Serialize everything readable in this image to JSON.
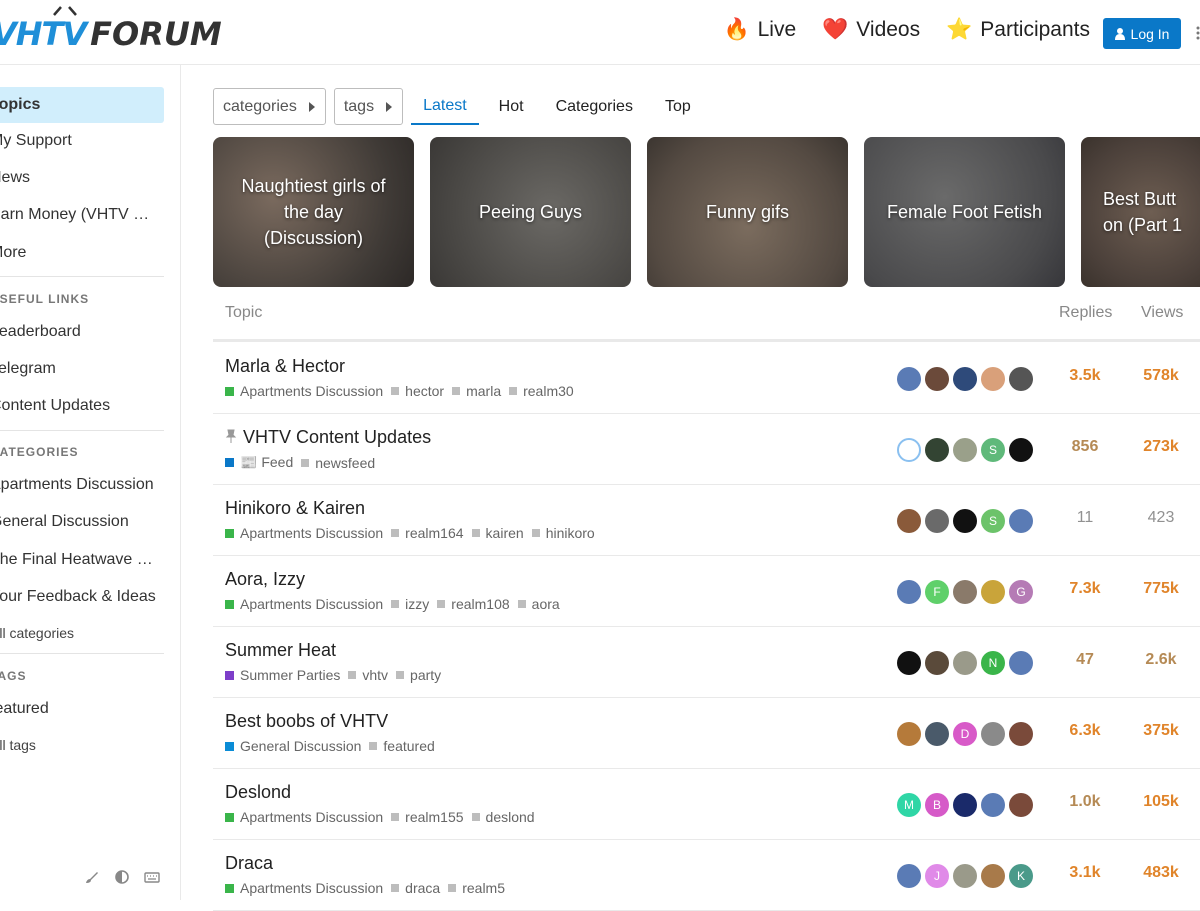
{
  "header": {
    "logo_left": "VHTV",
    "logo_right": "FORUM",
    "nav": [
      {
        "emoji": "🔥",
        "label": "Live"
      },
      {
        "emoji": "❤️",
        "label": "Videos"
      },
      {
        "emoji": "⭐",
        "label": "Participants"
      }
    ],
    "login_label": "Log In"
  },
  "sidebar": {
    "items": [
      "Topics",
      "My Support",
      "News",
      "Earn Money (VHTV …",
      "More"
    ],
    "useful_links_head": "USEFUL LINKS",
    "useful_links": [
      "Leaderboard",
      "Telegram",
      "Content Updates"
    ],
    "categories_head": "CATEGORIES",
    "categories": [
      "Apartments Discussion",
      "General Discussion",
      "The Final Heatwave …",
      "Your Feedback & Ideas"
    ],
    "all_categories": "All categories",
    "tags_head": "TAGS",
    "tags": [
      "featured"
    ],
    "all_tags": "All tags"
  },
  "filters": {
    "categories": "categories",
    "tags": "tags",
    "tabs": [
      "Latest",
      "Hot",
      "Categories",
      "Top"
    ]
  },
  "featured": [
    {
      "title": "Naughtiest girls of the day (Discussion)"
    },
    {
      "title": "Peeing Guys"
    },
    {
      "title": "Funny gifs"
    },
    {
      "title": "Female Foot Fetish"
    },
    {
      "title": "Best Butt on (Part 1"
    }
  ],
  "table": {
    "col_topic": "Topic",
    "col_replies": "Replies",
    "col_views": "Views",
    "rows": [
      {
        "title": "Marla & Hector",
        "pinned": false,
        "category": "Apartments Discussion",
        "cat_color": "#3ab54a",
        "tags": [
          "hector",
          "marla",
          "realm30"
        ],
        "replies": "3.5k",
        "views": "578k"
      },
      {
        "title": "VHTV Content Updates",
        "pinned": true,
        "category": "📰 Feed",
        "cat_color": "#0a78c8",
        "tags": [
          "newsfeed"
        ],
        "replies": "856",
        "views": "273k"
      },
      {
        "title": "Hinikoro & Kairen",
        "pinned": false,
        "category": "Apartments Discussion",
        "cat_color": "#3ab54a",
        "tags": [
          "realm164",
          "kairen",
          "hinikoro"
        ],
        "replies": "11",
        "views": "423"
      },
      {
        "title": "Aora, Izzy",
        "pinned": false,
        "category": "Apartments Discussion",
        "cat_color": "#3ab54a",
        "tags": [
          "izzy",
          "realm108",
          "aora"
        ],
        "replies": "7.3k",
        "views": "775k"
      },
      {
        "title": "Summer Heat",
        "pinned": false,
        "category": "Summer Parties",
        "cat_color": "#7d3ec9",
        "tags": [
          "vhtv",
          "party"
        ],
        "replies": "47",
        "views": "2.6k"
      },
      {
        "title": "Best boobs of VHTV",
        "pinned": false,
        "category": "General Discussion",
        "cat_color": "#0a8cd6",
        "tags": [
          "featured"
        ],
        "replies": "6.3k",
        "views": "375k"
      },
      {
        "title": "Deslond",
        "pinned": false,
        "category": "Apartments Discussion",
        "cat_color": "#3ab54a",
        "tags": [
          "realm155",
          "deslond"
        ],
        "replies": "1.0k",
        "views": "105k"
      },
      {
        "title": "Draca",
        "pinned": false,
        "category": "Apartments Discussion",
        "cat_color": "#3ab54a",
        "tags": [
          "draca",
          "realm5"
        ],
        "replies": "3.1k",
        "views": "483k"
      }
    ]
  },
  "avatars": [
    [
      "",
      "",
      "",
      "",
      ""
    ],
    [
      "",
      "",
      "",
      "S",
      ""
    ],
    [
      "",
      "",
      "",
      "S",
      ""
    ],
    [
      "",
      "F",
      "",
      "",
      "G"
    ],
    [
      "",
      "",
      "",
      "N",
      ""
    ],
    [
      "",
      "",
      "D",
      "",
      ""
    ],
    [
      "M",
      "B",
      "",
      "",
      ""
    ],
    [
      "",
      "J",
      "",
      "",
      "K"
    ]
  ],
  "colors": {
    "accent": "#0a78c8",
    "hot": "#e0842a",
    "active_bg": "#d1eefc"
  }
}
